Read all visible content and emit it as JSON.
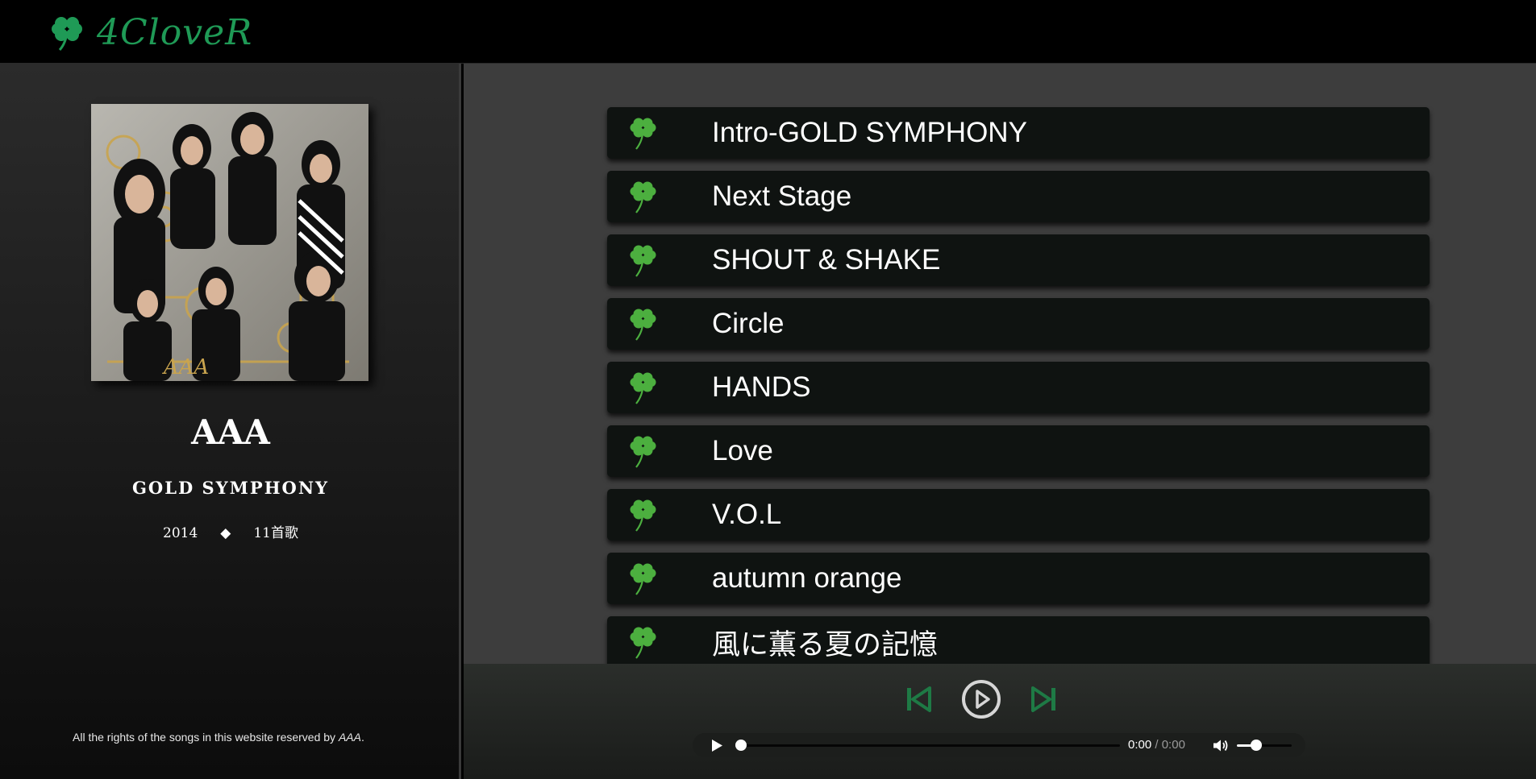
{
  "brand": {
    "name": "4CloveR",
    "color": "#1f9a56"
  },
  "album": {
    "artist": "AAA",
    "title": "GOLD SYMPHONY",
    "year": "2014",
    "separator": "◆",
    "track_count_label": "11首歌",
    "cover_icon": "album-cover-image"
  },
  "footer": {
    "copyright_prefix": "All the rights of the songs in this website reserved by ",
    "copyright_owner": "AAA",
    "copyright_suffix": "."
  },
  "tracks": [
    {
      "name": "Intro-GOLD SYMPHONY",
      "icon": "clover-icon"
    },
    {
      "name": "Next Stage",
      "icon": "clover-icon"
    },
    {
      "name": "SHOUT & SHAKE",
      "icon": "clover-icon"
    },
    {
      "name": "Circle",
      "icon": "clover-icon"
    },
    {
      "name": "HANDS",
      "icon": "clover-icon"
    },
    {
      "name": "Love",
      "icon": "clover-icon"
    },
    {
      "name": "V.O.L",
      "icon": "clover-icon"
    },
    {
      "name": "autumn orange",
      "icon": "clover-icon"
    },
    {
      "name": "風に薫る夏の記憶",
      "icon": "clover-icon"
    }
  ],
  "player": {
    "controls": [
      "skip-previous-icon",
      "play-circle-icon",
      "skip-next-icon"
    ],
    "accent_color": "#1e7a45",
    "current_time": "0:00",
    "time_separator": " / ",
    "duration": "0:00",
    "progress": 0,
    "volume": 0.35
  }
}
